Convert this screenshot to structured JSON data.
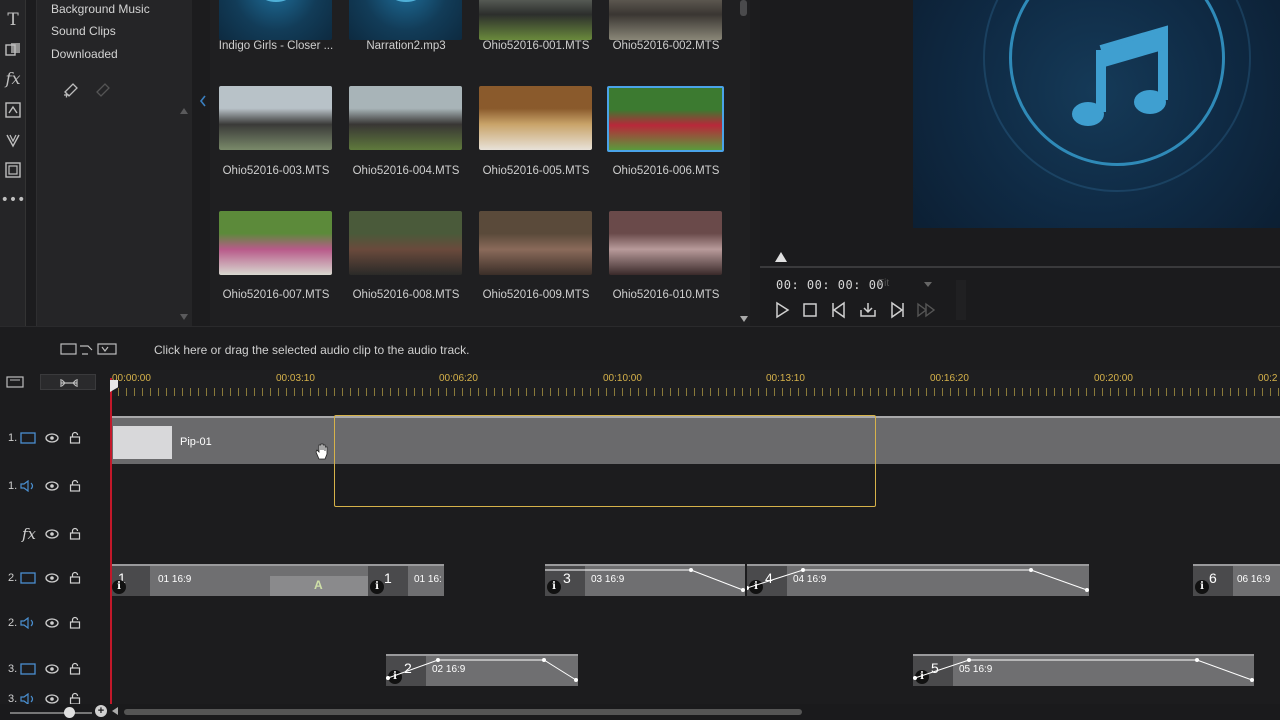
{
  "library": {
    "items": [
      "Background Music",
      "Sound Clips",
      "Downloaded"
    ]
  },
  "media": {
    "items": [
      {
        "label": "Indigo Girls - Closer ...",
        "kind": "audio"
      },
      {
        "label": "Narration2.mp3",
        "kind": "audio"
      },
      {
        "label": "Ohio52016-001.MTS",
        "kind": "video",
        "colors": [
          "#5a5e58",
          "#2c2e2c",
          "#6a8a3c"
        ]
      },
      {
        "label": "Ohio52016-002.MTS",
        "kind": "video",
        "colors": [
          "#5f5a52",
          "#3a3632",
          "#8a8778"
        ]
      },
      {
        "label": "Ohio52016-003.MTS",
        "kind": "video",
        "colors": [
          "#b8c2c8",
          "#3a3a38",
          "#7a8a6a"
        ]
      },
      {
        "label": "Ohio52016-004.MTS",
        "kind": "video",
        "colors": [
          "#a8b4b8",
          "#383634",
          "#5f7a3c"
        ]
      },
      {
        "label": "Ohio52016-005.MTS",
        "kind": "video",
        "colors": [
          "#8a5a2c",
          "#c9a46a",
          "#e8e2d8"
        ]
      },
      {
        "label": "Ohio52016-006.MTS",
        "kind": "video",
        "selected": true,
        "colors": [
          "#3c7a30",
          "#b8283a",
          "#5a9a3c"
        ]
      },
      {
        "label": "Ohio52016-007.MTS",
        "kind": "video",
        "colors": [
          "#5c8a3a",
          "#b85a8a",
          "#d8d8d0"
        ]
      },
      {
        "label": "Ohio52016-008.MTS",
        "kind": "video",
        "colors": [
          "#4a5a3a",
          "#6a4a3c",
          "#2a2a28"
        ]
      },
      {
        "label": "Ohio52016-009.MTS",
        "kind": "video",
        "colors": [
          "#5a4a3a",
          "#8a6a5a",
          "#3a2e28"
        ]
      },
      {
        "label": "Ohio52016-010.MTS",
        "kind": "video",
        "colors": [
          "#6a4a4a",
          "#b89a9a",
          "#3a2a2a"
        ]
      }
    ]
  },
  "preview": {
    "timecode": "00: 00: 00: 00",
    "fit_label": "Fit",
    "accent": "#2f8ab8"
  },
  "timeline": {
    "hint": "Click here or drag the selected audio clip to the audio track.",
    "ruler": [
      "00:00:00",
      "00:03:10",
      "00:06:20",
      "00:10:00",
      "00:13:10",
      "00:16:20",
      "00:20:00",
      "00:2"
    ],
    "ruler_color": "#d6b24a",
    "tracks": [
      {
        "num": "1.",
        "type": "video"
      },
      {
        "num": "1.",
        "type": "audio"
      },
      {
        "num": "fx",
        "type": "fx"
      },
      {
        "num": "2.",
        "type": "video"
      },
      {
        "num": "2.",
        "type": "audio"
      },
      {
        "num": "3.",
        "type": "video"
      },
      {
        "num": "3.",
        "type": "audio"
      }
    ],
    "pip_clip_label": "Pip-01",
    "clips": [
      {
        "num": "1",
        "tag": "01 16:9"
      },
      {
        "num": "1",
        "tag": "01 16:"
      },
      {
        "num": "3",
        "tag": "03 16:9"
      },
      {
        "num": "4",
        "tag": "04 16:9"
      },
      {
        "num": "6",
        "tag": "06 16:9"
      },
      {
        "num": "2",
        "tag": "02 16:9"
      },
      {
        "num": "5",
        "tag": "05 16:9"
      }
    ],
    "transition_label": "A",
    "playhead_color": "#c2182a"
  }
}
